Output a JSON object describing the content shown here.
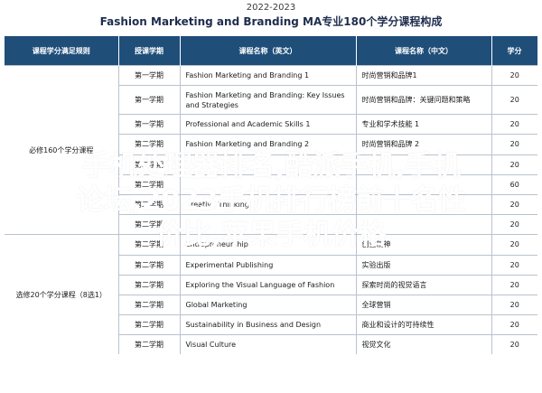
{
  "header": {
    "year": "2022-2023",
    "title": "Fashion Marketing and Branding MA专业180个学分课程构成"
  },
  "table": {
    "columns": [
      "课程学分满足规则",
      "授课学期",
      "课程名称（英文）",
      "课程名称（中文）",
      "学分"
    ],
    "groups": {
      "required": "必修160个学分课程",
      "elective": "选修20个学分课程（8选1）"
    },
    "rows": [
      {
        "semester": "第一学期",
        "en": "Fashion Marketing and Branding 1",
        "cn": "时尚营销和品牌1",
        "credits": "20"
      },
      {
        "semester": "第一学期",
        "en": "Fashion Marketing and Branding: Key Issues and Strategies",
        "cn": "时尚营销和品牌：关键问题和策略",
        "credits": "20"
      },
      {
        "semester": "第一学期",
        "en": "Professional and Academic Skills 1",
        "cn": "专业和学术技能 1",
        "credits": "20"
      },
      {
        "semester": "第二学期",
        "en": "Fashion Marketing and Branding 2",
        "cn": "时尚营销和品牌 2",
        "credits": "20"
      },
      {
        "semester": "第二学期",
        "en": "",
        "cn": "",
        "credits": "20"
      },
      {
        "semester": "第二学期",
        "en": "",
        "cn": "",
        "credits": "60"
      },
      {
        "semester": "第二学期",
        "en": "Creative Thinking",
        "cn": "",
        "credits": "20"
      },
      {
        "semester": "第二学期",
        "en": "",
        "cn": "",
        "credits": "20"
      },
      {
        "semester": "第二学期",
        "en": "Entrepreneurship",
        "cn": "创业精神",
        "credits": "20"
      },
      {
        "semester": "第二学期",
        "en": "Experimental Publishing",
        "cn": "实验出版",
        "credits": "20"
      },
      {
        "semester": "第二学期",
        "en": "Exploring the Visual Language of Fashion",
        "cn": "探索时尚的视觉语言",
        "credits": "20"
      },
      {
        "semester": "第二学期",
        "en": "Global Marketing",
        "cn": "全球营销",
        "credits": "20"
      },
      {
        "semester": "第二学期",
        "en": "Sustainability in Business and Design",
        "cn": "商业和设计的可持续性",
        "credits": "20"
      },
      {
        "semester": "第二学期",
        "en": "Visual Culture",
        "cn": "视觉文化",
        "credits": "20"
      }
    ]
  },
  "overlay": {
    "line1": "手机处理器排名,酷派手机,手机",
    "line2": "论坛,2023手机排行榜前十名性",
    "line3": "价比,苹果手机价格"
  },
  "colors": {
    "header_bg": "#1f4e79",
    "overlay_text": "#ffffff"
  }
}
